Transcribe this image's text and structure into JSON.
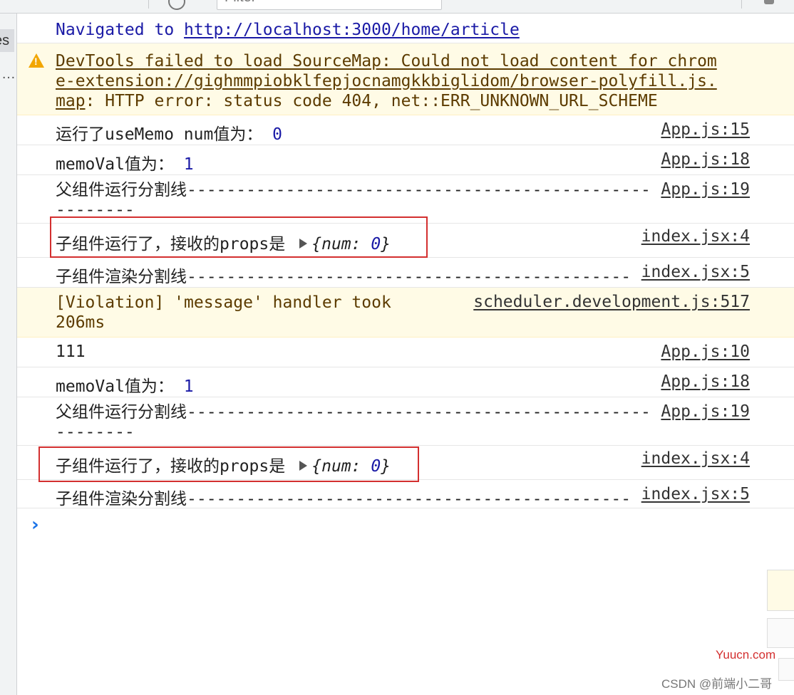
{
  "toolbar": {
    "filter_placeholder": "Filter"
  },
  "left_panel": {
    "tab_label": "es",
    "more_label": "…"
  },
  "console": {
    "nav_prefix": "Navigated to ",
    "nav_url": "http://localhost:3000/home/article",
    "warning_lines": [
      "DevTools failed to load SourceMap: Could not load content for chrom",
      "e-extension://gighmmpiobklfepjocnamgkkbiglidom/browser-polyfill.js.",
      "map"
    ],
    "warning_tail": ": HTTP error: status code 404, net::ERR_UNKNOWN_URL_SCHEME",
    "logs": [
      {
        "text": "运行了useMemo num值为： ",
        "value": "0",
        "source": "App.js:15"
      },
      {
        "text": "memoVal值为： ",
        "value": "1",
        "source": "App.js:18"
      },
      {
        "text": "父组件运行分割线-----------------------------------------------",
        "text2": "--------",
        "source": "App.js:19"
      },
      {
        "text": "子组件运行了，接收的props是",
        "obj_open": "{",
        "obj_key": "num: ",
        "obj_val": "0",
        "obj_close": "}",
        "source": "index.jsx:4"
      },
      {
        "text": "子组件渲染分割线---------------------------------------------",
        "source": "index.jsx:5"
      },
      {
        "text": "[Violation] 'message' handler took",
        "text2": "206ms",
        "source": "scheduler.development.js:517"
      },
      {
        "text": "111",
        "source": "App.js:10"
      },
      {
        "text": "memoVal值为： ",
        "value": "1",
        "source": "App.js:18"
      },
      {
        "text": "父组件运行分割线-----------------------------------------------",
        "text2": "--------",
        "source": "App.js:19"
      },
      {
        "text": "子组件运行了，接收的props是",
        "obj_open": "{",
        "obj_key": "num: ",
        "obj_val": "0",
        "obj_close": "}",
        "source": "index.jsx:4"
      },
      {
        "text": "子组件渲染分割线---------------------------------------------",
        "source": "index.jsx:5"
      }
    ],
    "prompt_symbol": "›"
  },
  "watermark": {
    "site": "Yuucn.com",
    "author": "CSDN @前端小二哥"
  }
}
